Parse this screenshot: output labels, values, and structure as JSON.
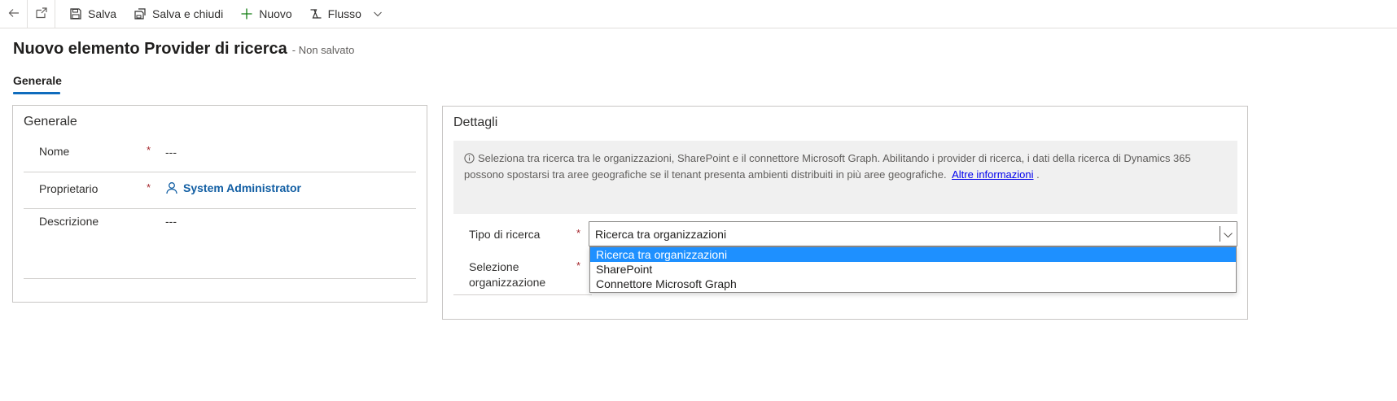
{
  "toolbar": {
    "save_label": "Salva",
    "save_close_label": "Salva e chiudi",
    "new_label": "Nuovo",
    "flow_label": "Flusso"
  },
  "header": {
    "title": "Nuovo elemento Provider di ricerca",
    "status": "- Non salvato"
  },
  "tabs": [
    {
      "label": "Generale"
    }
  ],
  "general_section": {
    "title": "Generale",
    "fields": [
      {
        "label": "Nome",
        "required": "*",
        "value": "---"
      },
      {
        "label": "Proprietario",
        "required": "*",
        "value": "System Administrator"
      },
      {
        "label": "Descrizione",
        "value": "---"
      }
    ]
  },
  "details_section": {
    "title": "Dettagli",
    "info_text": "Seleziona tra ricerca tra le organizzazioni, SharePoint e il connettore Microsoft Graph. Abilitando i provider di ricerca, i dati della ricerca di Dynamics 365 possono spostarsi tra aree geografiche se il tenant presenta ambienti distribuiti in più aree geografiche.",
    "info_link": "Altre informazioni",
    "info_tail": ".",
    "search_type": {
      "label": "Tipo di ricerca",
      "required": "*",
      "selected": "Ricerca tra organizzazioni",
      "options": [
        "Ricerca tra organizzazioni",
        "SharePoint",
        "Connettore Microsoft Graph"
      ]
    },
    "org_selection": {
      "label_line1": "Selezione",
      "label_line2": "organizzazione",
      "required": "*"
    }
  },
  "colors": {
    "accent": "#0f6cbd",
    "required": "#a4262c",
    "selected_option": "#1e90ff",
    "link": "#115ea3"
  }
}
